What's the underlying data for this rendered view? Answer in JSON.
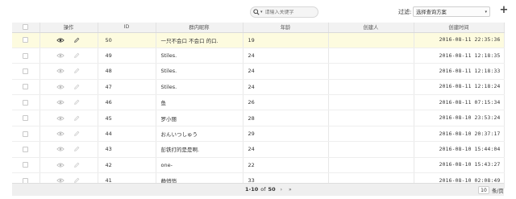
{
  "toolbar": {
    "search_placeholder": "请输入关键字",
    "filter_label": "过滤:",
    "filter_selected": "选择查询方案",
    "add_label": "+"
  },
  "table": {
    "columns": [
      "",
      "操作",
      "ID",
      "群内昵称",
      "年龄",
      "创建人",
      "创建时间"
    ],
    "rows": [
      {
        "id": "50",
        "name": "一只不会口 不会口 的口.",
        "age": "19",
        "creator": "",
        "time": "2016-08-11 22:35:36",
        "selected": true
      },
      {
        "id": "49",
        "name": "Stiles.",
        "age": "24",
        "creator": "",
        "time": "2016-08-11 12:18:35",
        "selected": false
      },
      {
        "id": "48",
        "name": "Stiles.",
        "age": "24",
        "creator": "",
        "time": "2016-08-11 12:18:33",
        "selected": false
      },
      {
        "id": "47",
        "name": "Stiles.",
        "age": "24",
        "creator": "",
        "time": "2016-08-11 12:18:24",
        "selected": false
      },
      {
        "id": "46",
        "name": "鱼",
        "age": "26",
        "creator": "",
        "time": "2016-08-11 07:15:34",
        "selected": false
      },
      {
        "id": "45",
        "name": "罗小丽",
        "age": "28",
        "creator": "",
        "time": "2016-08-10 23:53:24",
        "selected": false
      },
      {
        "id": "44",
        "name": "おんいつしゅう",
        "age": "29",
        "creator": "",
        "time": "2016-08-10 20:37:17",
        "selected": false
      },
      {
        "id": "43",
        "name": "彭铁打的是是啊.",
        "age": "24",
        "creator": "",
        "time": "2016-08-10 15:44:04",
        "selected": false
      },
      {
        "id": "42",
        "name": "one-",
        "age": "22",
        "creator": "",
        "time": "2016-08-10 15:43:27",
        "selected": false
      },
      {
        "id": "41",
        "name": "静悄悄",
        "age": "33",
        "creator": "",
        "time": "2016-08-10 02:08:49",
        "selected": false
      }
    ]
  },
  "footer": {
    "range": "1-10",
    "of_word": "of",
    "total": "50",
    "next": "›",
    "last": "»",
    "page_size": "10",
    "page_size_unit": "条/页"
  },
  "colors": {
    "selected_row": "#fdfbdf",
    "header_bg": "#f2f2f2",
    "footer_bg": "#efefef"
  },
  "icons": {
    "view": "eye-icon",
    "edit": "pencil-icon",
    "search": "magnifier-icon"
  }
}
